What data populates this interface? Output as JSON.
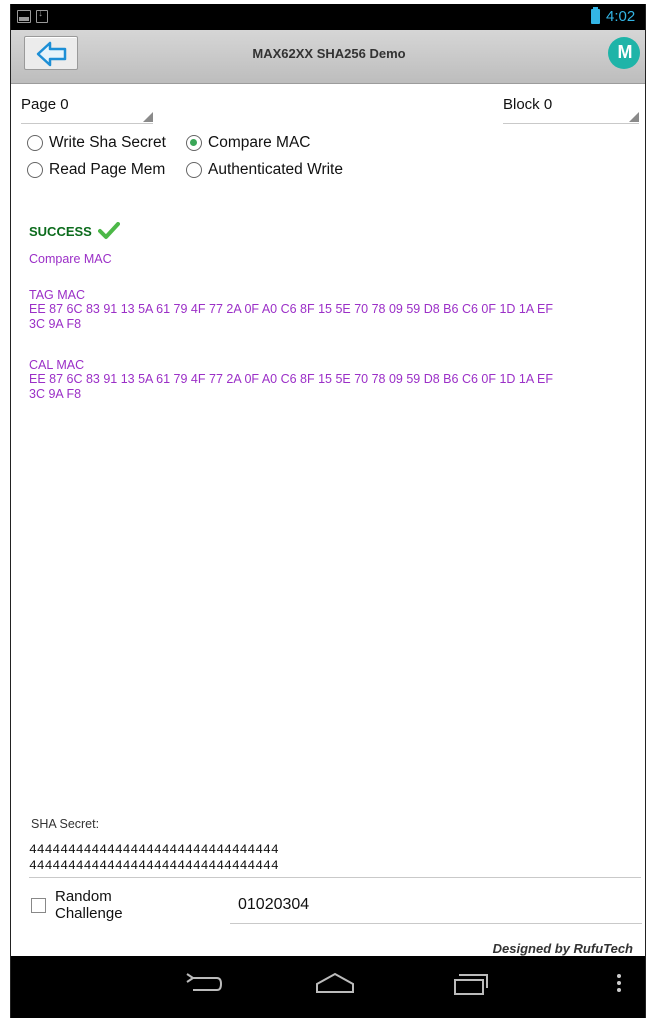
{
  "status_bar": {
    "time": "4:02",
    "accent_color": "#33b5e5"
  },
  "title_bar": {
    "title": "MAX62XX SHA256 Demo",
    "back_icon": "arrow-left-icon",
    "logo_text": "M"
  },
  "selectors": {
    "page": "Page 0",
    "block": "Block 0"
  },
  "operations": [
    {
      "label": "Write Sha Secret",
      "checked": false
    },
    {
      "label": "Compare MAC",
      "checked": true
    },
    {
      "label": "Read Page Mem",
      "checked": false
    },
    {
      "label": "Authenticated Write",
      "checked": false
    }
  ],
  "output": {
    "status": "SUCCESS",
    "status_color": "#0b6b1c",
    "operation": "Compare MAC",
    "tag_mac_label": "TAG MAC",
    "tag_mac_line1": "EE 87 6C 83 91 13 5A 61 79 4F 77 2A 0F A0 C6 8F 15 5E 70 78 09 59 D8 B6 C6 0F 1D 1A EF",
    "tag_mac_line2": "3C 9A F8",
    "cal_mac_label": "CAL MAC",
    "cal_mac_line1": "EE 87 6C 83 91 13 5A 61 79 4F 77 2A 0F A0 C6 8F 15 5E 70 78 09 59 D8 B6 C6 0F 1D 1A EF",
    "cal_mac_line2": "3C 9A F8",
    "text_color": "#9b2fc7"
  },
  "form": {
    "sha_secret_label": "SHA Secret:",
    "sha_secret_line1": "44444444444444444444444444444444",
    "sha_secret_line2": "44444444444444444444444444444444",
    "random_challenge_label": "Random Challenge",
    "random_challenge_checked": false,
    "challenge_value": "01020304"
  },
  "footer": {
    "credit": "Designed by RufuTech"
  },
  "nav_bar": {
    "back_icon": "back-icon",
    "home_icon": "home-icon",
    "recents_icon": "recents-icon",
    "menu_icon": "overflow-menu-icon"
  }
}
